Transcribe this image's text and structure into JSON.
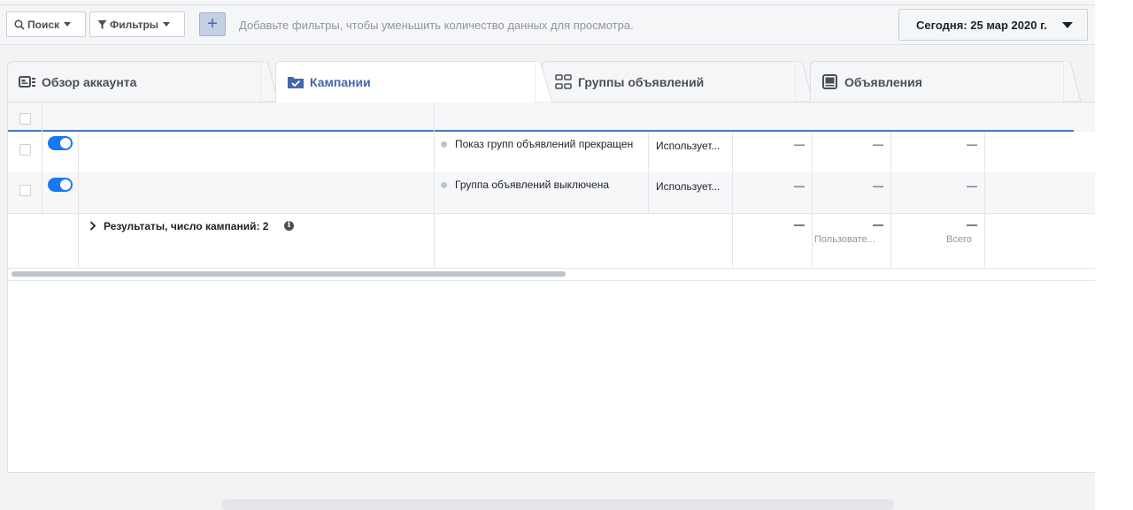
{
  "toolbar": {
    "search_label": "Поиск",
    "filters_label": "Фильтры",
    "add_label": "+",
    "filter_hint": "Добавьте фильтры, чтобы уменьшить количество данных для просмотра.",
    "date_label": "Сегодня: 25 мар 2020 г."
  },
  "tabs": [
    {
      "label": "Обзор аккаунта",
      "icon": "account-overview-icon",
      "active": false
    },
    {
      "label": "Кампании",
      "icon": "folder-check-icon",
      "active": true
    },
    {
      "label": "Группы объявлений",
      "icon": "grid-icon",
      "active": false
    },
    {
      "label": "Объявления",
      "icon": "ad-icon",
      "active": false
    }
  ],
  "rows": [
    {
      "toggle_on": true,
      "delivery": "Показ групп объявлений прекращен",
      "strategy": "Использует...",
      "c1": "—",
      "c2": "—",
      "c3": "—"
    },
    {
      "toggle_on": true,
      "delivery": "Группа объявлений выключена",
      "strategy": "Использует...",
      "c1": "—",
      "c2": "—",
      "c3": "—"
    }
  ],
  "summary": {
    "chevron": "›",
    "title": "Результаты, число кампаний: 2",
    "info": "i",
    "c1": "—",
    "c2": "—",
    "c2_sub": "Пользовате...",
    "c3": "—",
    "c3_sub": "Всего"
  },
  "colors": {
    "accent": "#4267b2",
    "toggle": "#1877f2",
    "header_line": "#4a77ba"
  }
}
